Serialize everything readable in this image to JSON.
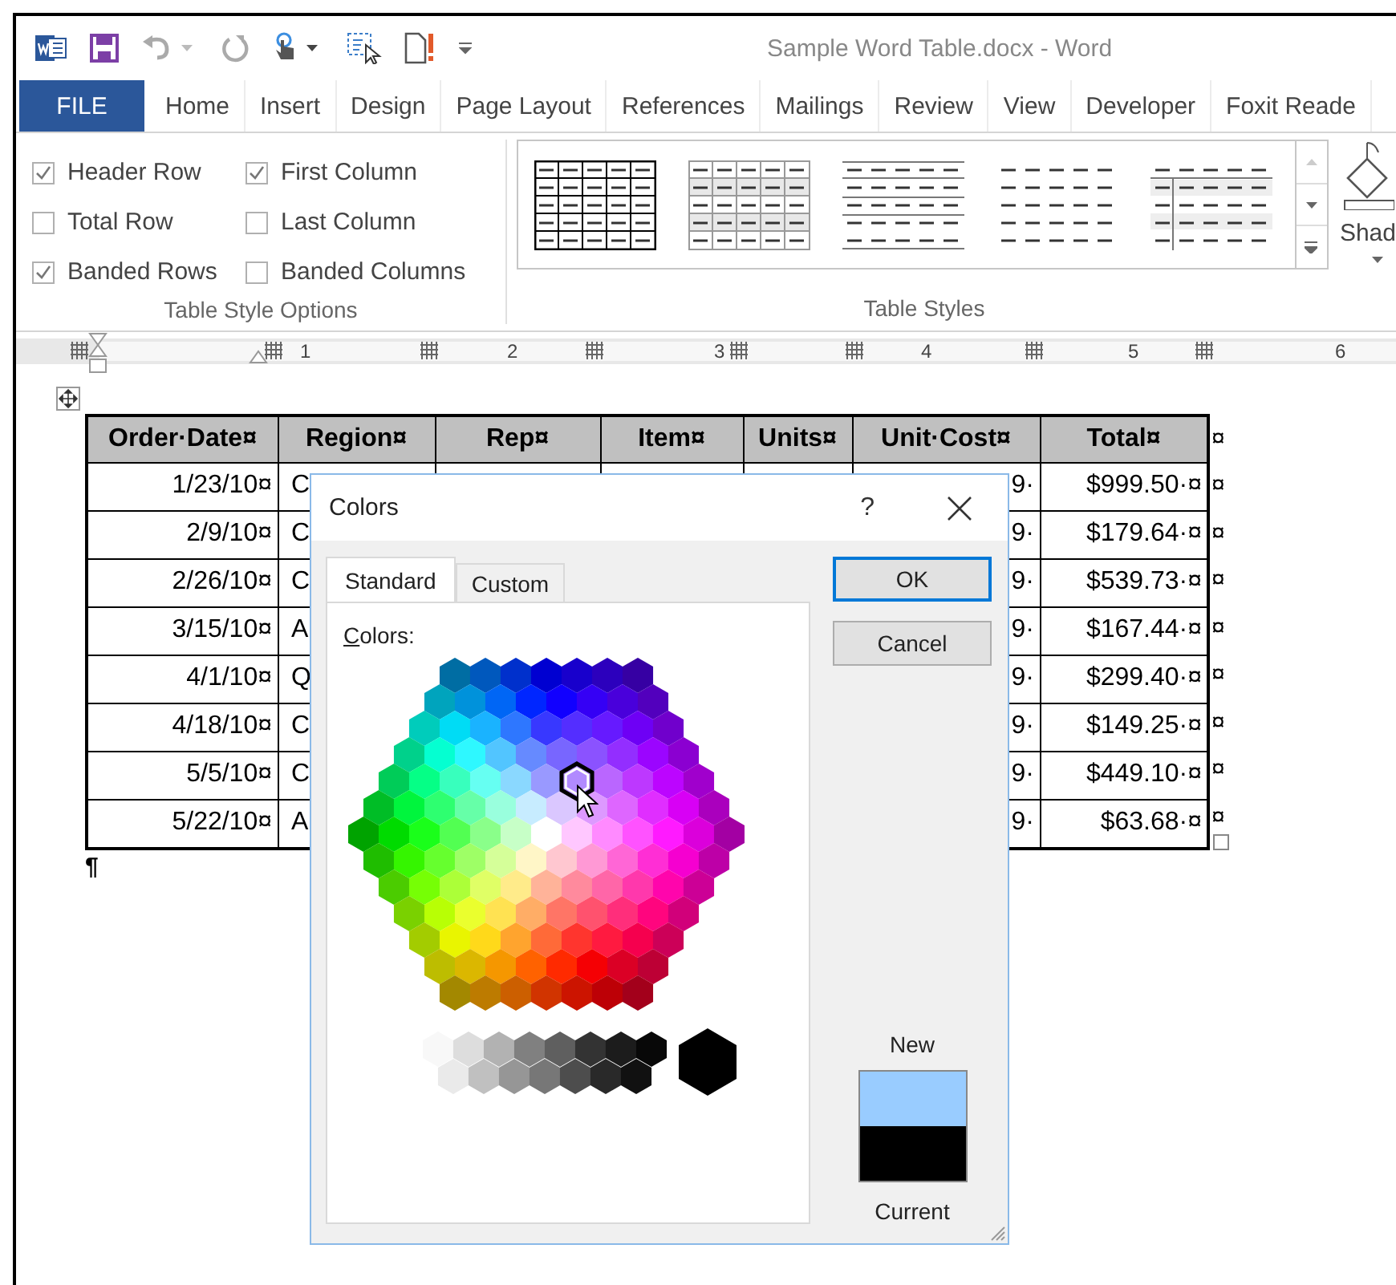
{
  "window": {
    "title": "Sample Word Table.docx - Word"
  },
  "ribbon_tabs": [
    {
      "label": "FILE",
      "kind": "file"
    },
    {
      "label": "Home",
      "kind": "tab"
    },
    {
      "label": "Insert",
      "kind": "tab"
    },
    {
      "label": "Design",
      "kind": "tab"
    },
    {
      "label": "Page Layout",
      "kind": "tab"
    },
    {
      "label": "References",
      "kind": "tab"
    },
    {
      "label": "Mailings",
      "kind": "tab"
    },
    {
      "label": "Review",
      "kind": "tab"
    },
    {
      "label": "View",
      "kind": "tab"
    },
    {
      "label": "Developer",
      "kind": "tab"
    },
    {
      "label": "Foxit Reade",
      "kind": "tab"
    }
  ],
  "table_style_options": {
    "title": "Table Style Options",
    "options": [
      {
        "label": "Header Row",
        "checked": true
      },
      {
        "label": "Total Row",
        "checked": false
      },
      {
        "label": "Banded Rows",
        "checked": true
      },
      {
        "label": "First Column",
        "checked": true
      },
      {
        "label": "Last Column",
        "checked": false
      },
      {
        "label": "Banded Columns",
        "checked": false
      }
    ]
  },
  "table_styles": {
    "title": "Table Styles"
  },
  "shading": {
    "label": "Shad"
  },
  "ruler": {
    "numbers": [
      "1",
      "2",
      "3",
      "4",
      "5",
      "6"
    ]
  },
  "table": {
    "columns": [
      "Order·Date¤",
      "Region¤",
      "Rep¤",
      "Item¤",
      "Units¤",
      "Unit·Cost¤",
      "Total¤"
    ],
    "header_end_mark": "¤",
    "rows": [
      {
        "order_date": "1/23/10¤",
        "region": "C",
        "unit_cost": "9·",
        "total": "$999.50·¤",
        "end_mark": "¤"
      },
      {
        "order_date": "2/9/10¤",
        "region": "C",
        "unit_cost": "9·",
        "total": "$179.64·¤",
        "end_mark": "¤"
      },
      {
        "order_date": "2/26/10¤",
        "region": "C",
        "unit_cost": "9·",
        "total": "$539.73·¤",
        "end_mark": "¤"
      },
      {
        "order_date": "3/15/10¤",
        "region": "A",
        "unit_cost": "9·",
        "total": "$167.44·¤",
        "end_mark": "¤"
      },
      {
        "order_date": "4/1/10¤",
        "region": "Q",
        "unit_cost": "9·",
        "total": "$299.40·¤",
        "end_mark": "¤"
      },
      {
        "order_date": "4/18/10¤",
        "region": "C",
        "unit_cost": "9·",
        "total": "$149.25·¤",
        "end_mark": "¤"
      },
      {
        "order_date": "5/5/10¤",
        "region": "C",
        "unit_cost": "9·",
        "total": "$449.10·¤",
        "end_mark": "¤"
      },
      {
        "order_date": "5/22/10¤",
        "region": "A",
        "unit_cost": "9·",
        "total": "$63.68·¤",
        "end_mark": "¤"
      }
    ]
  },
  "paragraph_mark": "¶",
  "dialog": {
    "title": "Colors",
    "help": "?",
    "tabs": [
      {
        "label": "Standard",
        "selected": true
      },
      {
        "label": "Custom",
        "selected": false
      }
    ],
    "colors_label": "Colors:",
    "buttons": [
      {
        "label": "OK",
        "default": true
      },
      {
        "label": "Cancel",
        "default": false
      }
    ],
    "new_label": "New",
    "current_label": "Current"
  }
}
